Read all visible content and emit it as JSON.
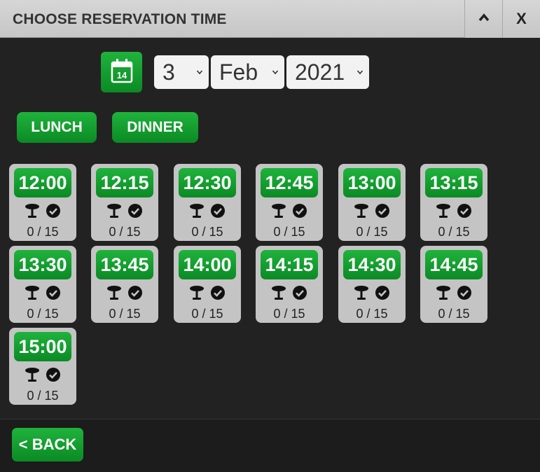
{
  "dialog": {
    "title": "CHOOSE RESERVATION TIME",
    "minimize_icon": "chevron-up-icon",
    "close_label": "X"
  },
  "date_picker": {
    "calendar_icon": "calendar-icon",
    "calendar_day": "14",
    "day": "3",
    "month": "Feb",
    "year": "2021"
  },
  "meal_tabs": {
    "lunch_label": "LUNCH",
    "dinner_label": "DINNER"
  },
  "slot_icons": [
    "table-icon",
    "check-circle-icon"
  ],
  "slots": [
    {
      "time": "12:00",
      "capacity": "0 / 15"
    },
    {
      "time": "12:15",
      "capacity": "0 / 15"
    },
    {
      "time": "12:30",
      "capacity": "0 / 15"
    },
    {
      "time": "12:45",
      "capacity": "0 / 15"
    },
    {
      "time": "13:00",
      "capacity": "0 / 15"
    },
    {
      "time": "13:15",
      "capacity": "0 / 15"
    },
    {
      "time": "13:30",
      "capacity": "0 / 15"
    },
    {
      "time": "13:45",
      "capacity": "0 / 15"
    },
    {
      "time": "14:00",
      "capacity": "0 / 15"
    },
    {
      "time": "14:15",
      "capacity": "0 / 15"
    },
    {
      "time": "14:30",
      "capacity": "0 / 15"
    },
    {
      "time": "14:45",
      "capacity": "0 / 15"
    },
    {
      "time": "15:00",
      "capacity": "0 / 15"
    }
  ],
  "footer": {
    "back_label": "< BACK"
  },
  "colors": {
    "accent_green": "#0fa02d",
    "background": "#222222",
    "slot_card": "#c4c4c4",
    "titlebar": "#d0d0d0"
  }
}
